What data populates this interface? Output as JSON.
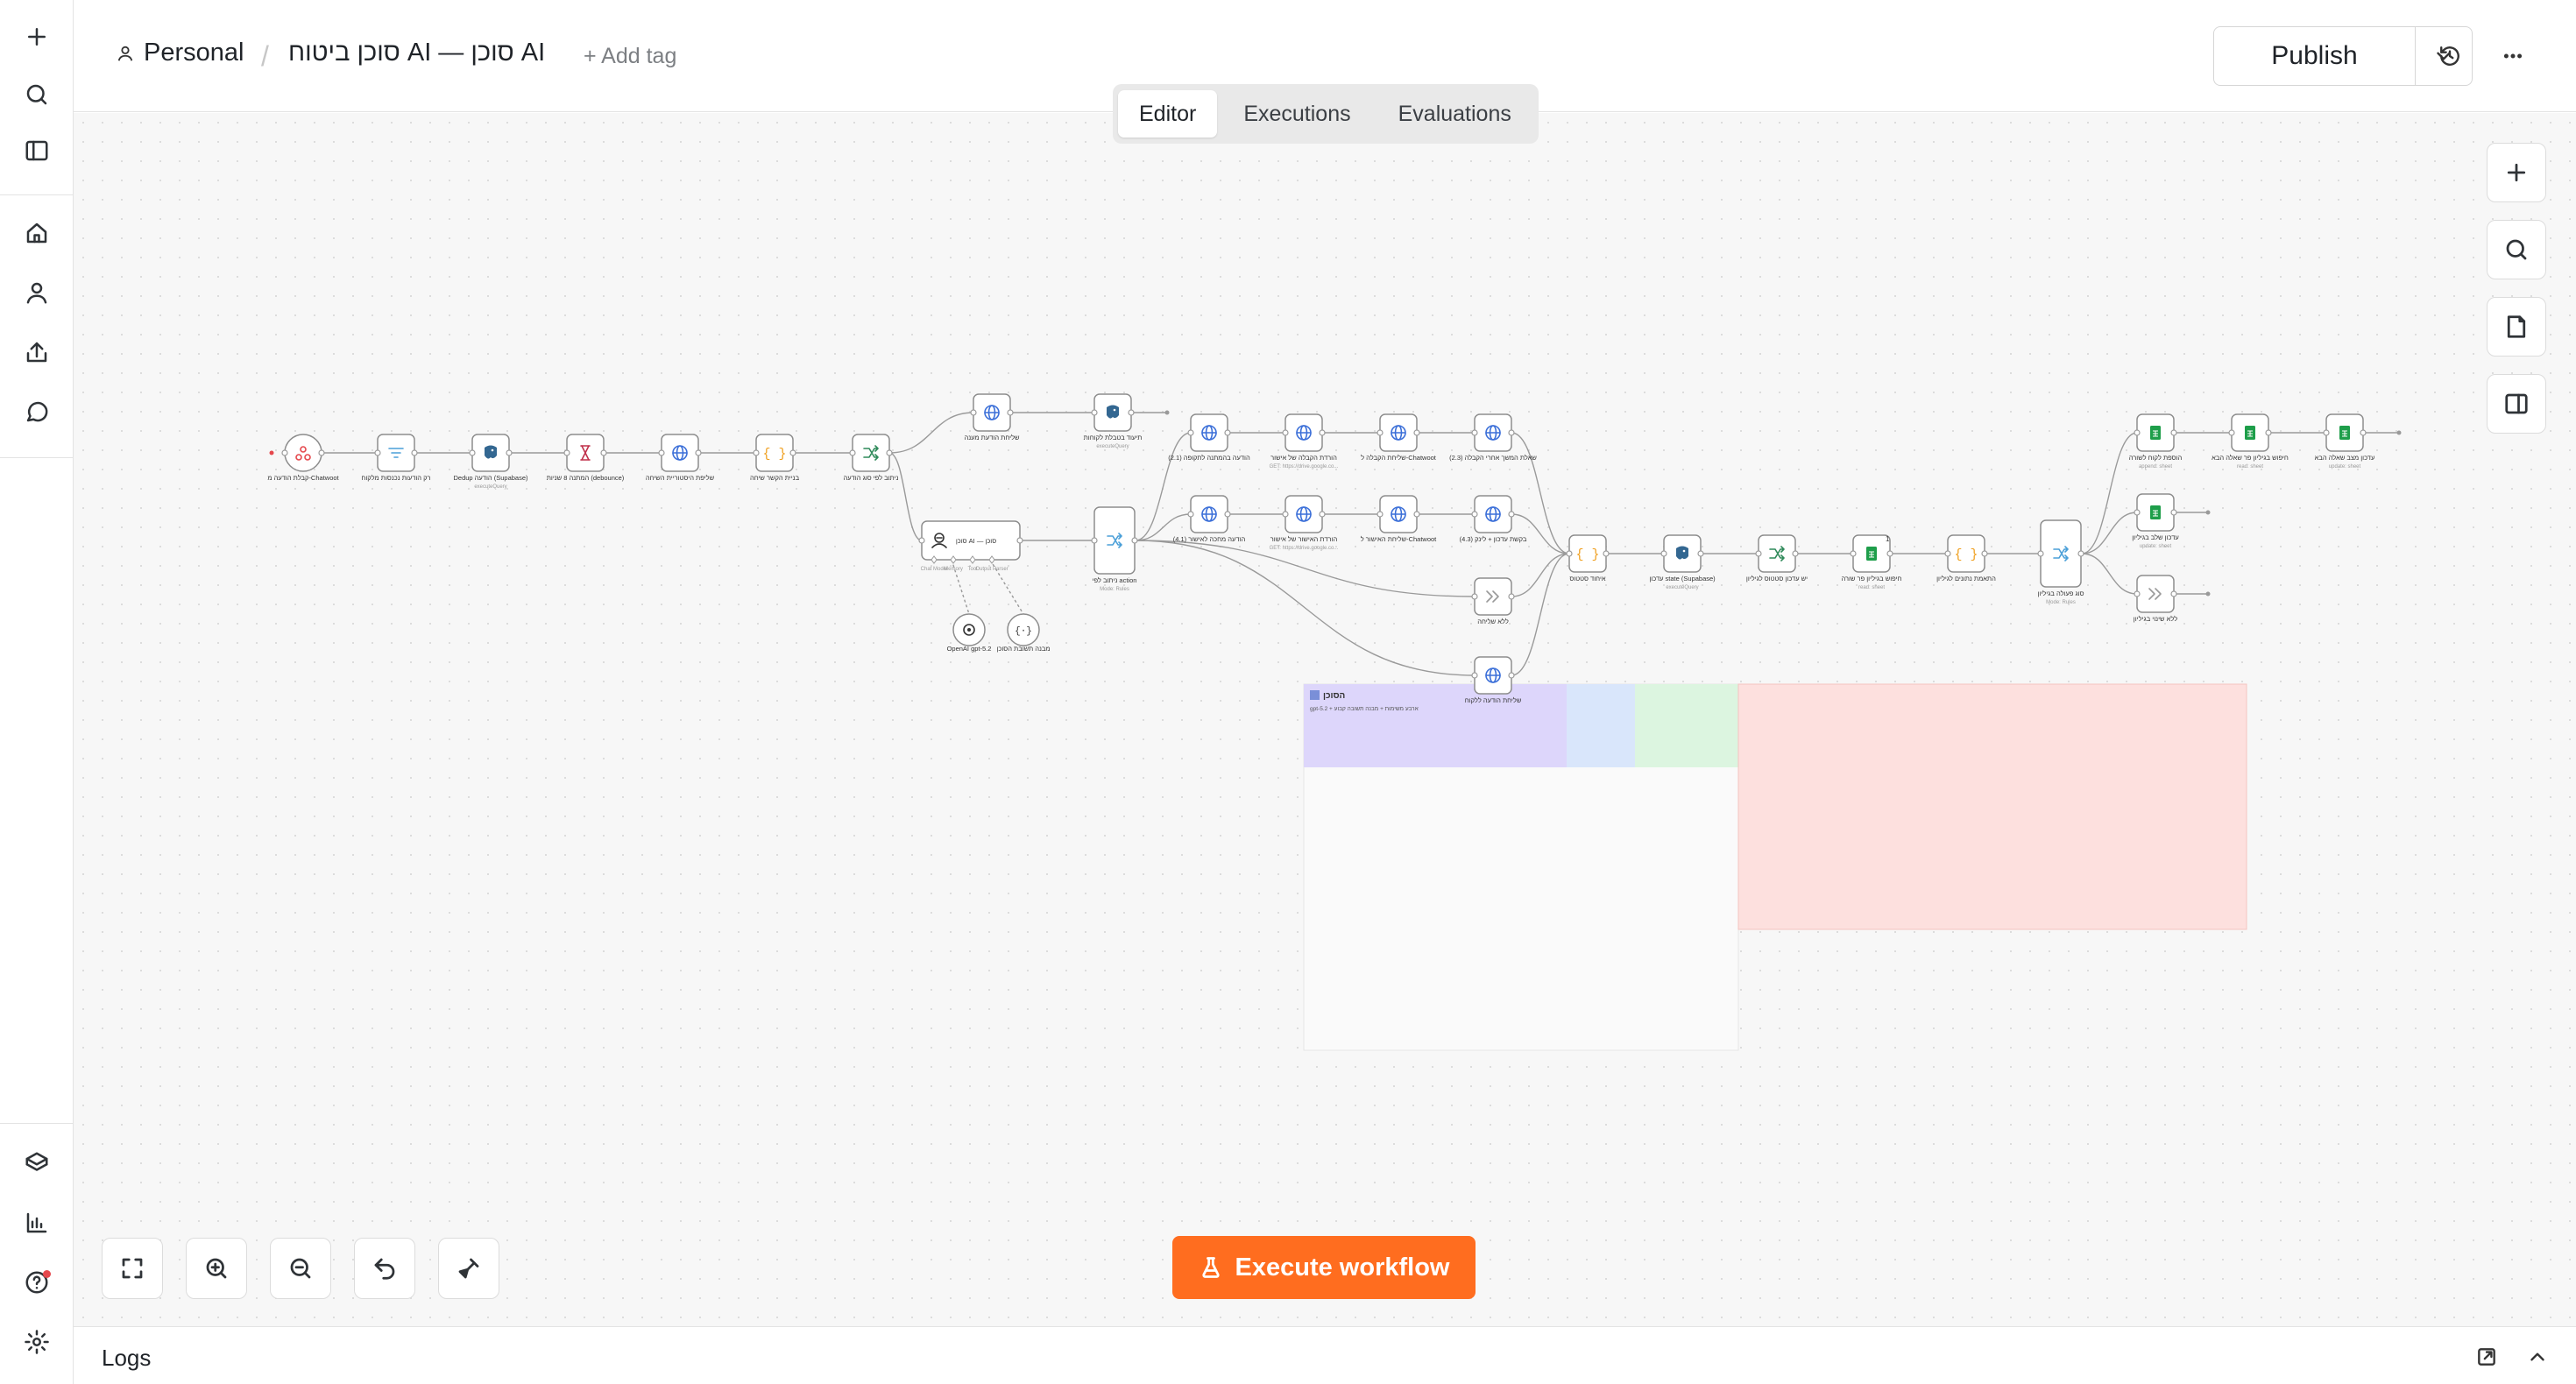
{
  "rail": {
    "items": [
      {
        "name": "add-icon"
      },
      {
        "name": "search-icon"
      },
      {
        "name": "sidebar-toggle-icon"
      },
      {
        "name": "home-icon"
      },
      {
        "name": "user-icon"
      },
      {
        "name": "share-icon"
      },
      {
        "name": "chat-icon"
      },
      {
        "name": "templates-icon"
      },
      {
        "name": "insights-icon"
      },
      {
        "name": "help-icon"
      },
      {
        "name": "settings-icon"
      }
    ]
  },
  "header": {
    "project": "Personal",
    "separator": "/",
    "workflow_name": "סוכן ביטוח AI — סוכן AI",
    "add_tag": "+ Add tag",
    "publish": "Publish"
  },
  "tabs": [
    {
      "label": "Editor",
      "active": true
    },
    {
      "label": "Executions",
      "active": false
    },
    {
      "label": "Evaluations",
      "active": false
    }
  ],
  "canvas": {
    "execute_label": "Execute workflow",
    "accent_color": "#ff6d1f"
  },
  "nodes": [
    {
      "id": "n1",
      "label": "קבלת הודעה מ-Chatwoot",
      "sub": "",
      "icon": "webhook",
      "color": "#e5484d"
    },
    {
      "id": "n2",
      "label": "רק הודעות נכנסות מלקוח",
      "sub": "",
      "icon": "filter",
      "color": "#4a9fd8"
    },
    {
      "id": "n3",
      "label": "Dedup הודעה (Supabase)",
      "sub": "executeQuery",
      "icon": "postgres",
      "color": "#336791"
    },
    {
      "id": "n4",
      "label": "המתנה 8 שניות (debounce)",
      "sub": "",
      "icon": "wait",
      "color": "#c0304a"
    },
    {
      "id": "n5",
      "label": "שליפת היסטוריית השיחה",
      "sub": "",
      "icon": "http",
      "color": "#3b6fd8"
    },
    {
      "id": "n6",
      "label": "בניית הקשר שיחה",
      "sub": "",
      "icon": "code",
      "color": "#f0a020"
    },
    {
      "id": "n7",
      "label": "ניתוב לפי סוג הודעה",
      "sub": "",
      "icon": "switch",
      "color": "#2f8a5a"
    },
    {
      "id": "n8",
      "label": "שליחת הודעת מענה",
      "sub": "",
      "icon": "http",
      "color": "#3b6fd8"
    },
    {
      "id": "n9",
      "label": "תיעוד בטבלת לקוחות",
      "sub": "executeQuery",
      "icon": "postgres",
      "color": "#336791"
    },
    {
      "id": "n10",
      "label": "סוכן AI — סוכן",
      "sub": "",
      "icon": "agent",
      "color": "#333"
    },
    {
      "id": "n11",
      "label": "ניתוב לפי action",
      "sub": "Mode: Rules",
      "icon": "switch",
      "color": "#4a9fd8"
    },
    {
      "id": "n12",
      "label": "הודעה בהמתנה לתקופה (2.1)",
      "sub": "",
      "icon": "http",
      "color": "#3b6fd8"
    },
    {
      "id": "n13",
      "label": "הורדת הקבלה של אישור",
      "sub": "GET: https://drive.google.co...",
      "icon": "http",
      "color": "#3b6fd8"
    },
    {
      "id": "n14",
      "label": "שליחת הקבלה ל-Chatwoot",
      "sub": "",
      "icon": "http",
      "color": "#3b6fd8"
    },
    {
      "id": "n15",
      "label": "שאלת המשך אחרי הקבלה (2.3)",
      "sub": "",
      "icon": "http",
      "color": "#3b6fd8"
    },
    {
      "id": "n16",
      "label": "הודעה מחכה לאישור (4.1)",
      "sub": "",
      "icon": "http",
      "color": "#3b6fd8"
    },
    {
      "id": "n17",
      "label": "הורדת האישור של אישור",
      "sub": "GET: https://drive.google.co...",
      "icon": "http",
      "color": "#3b6fd8"
    },
    {
      "id": "n18",
      "label": "שליחת האישור ל-Chatwoot",
      "sub": "",
      "icon": "http",
      "color": "#3b6fd8"
    },
    {
      "id": "n19",
      "label": "בקשת עדכון + לינק (4.3)",
      "sub": "",
      "icon": "http",
      "color": "#3b6fd8"
    },
    {
      "id": "n20",
      "label": "ללא שליחה",
      "sub": "",
      "icon": "noop",
      "color": "#999"
    },
    {
      "id": "n21",
      "label": "שליחת הודעה ללקוח",
      "sub": "",
      "icon": "http",
      "color": "#3b6fd8"
    },
    {
      "id": "n22",
      "label": "איחוד סטטוס",
      "sub": "",
      "icon": "code",
      "color": "#f0a020"
    },
    {
      "id": "n23",
      "label": "עדכון state (Supabase)",
      "sub": "executeQuery",
      "icon": "postgres",
      "color": "#336791"
    },
    {
      "id": "n24",
      "label": "יש עדכון סטטוס לגיליון",
      "sub": "",
      "icon": "switch",
      "color": "#2f8a5a"
    },
    {
      "id": "n25",
      "label": "חיפוש בגיליון פר שורה",
      "sub": "read: sheet",
      "icon": "sheets",
      "color": "#1e9e4a"
    },
    {
      "id": "n26",
      "label": "התאמת נתונים לגיליון",
      "sub": "",
      "icon": "code",
      "color": "#f0a020"
    },
    {
      "id": "n27",
      "label": "סוג פעולה בגיליון",
      "sub": "Mode: Rules",
      "icon": "switch",
      "color": "#4a9fd8"
    },
    {
      "id": "n28",
      "label": "הוספת לקוח לשורה",
      "sub": "append: sheet",
      "icon": "sheets",
      "color": "#1e9e4a"
    },
    {
      "id": "n29",
      "label": "חיפוש בגיליון פר שאלה הבא",
      "sub": "read: sheet",
      "icon": "sheets",
      "color": "#1e9e4a"
    },
    {
      "id": "n30",
      "label": "עדכון מצב שאלה הבא",
      "sub": "update: sheet",
      "icon": "sheets",
      "color": "#1e9e4a"
    },
    {
      "id": "n31",
      "label": "עדכון שלב בגיליון",
      "sub": "update: sheet",
      "icon": "sheets",
      "color": "#1e9e4a"
    },
    {
      "id": "n32",
      "label": "ללא שינוי בגיליון",
      "sub": "",
      "icon": "noop",
      "color": "#999"
    },
    {
      "id": "n33",
      "label": "OpenAI gpt-5.2",
      "sub": "",
      "icon": "openai",
      "color": "#333"
    },
    {
      "id": "n34",
      "label": "מבנה תשובת הסוכן",
      "sub": "",
      "icon": "parser",
      "color": "#333"
    }
  ],
  "agent_ports": [
    "Chat Model",
    "Memory",
    "Tool",
    "Output Parser"
  ],
  "sticky": {
    "title": "הסוכן",
    "body": "gpt-5.2 + ארבע משימות + מבנה תשובה קבוע",
    "badge": "1"
  },
  "logs": {
    "label": "Logs"
  }
}
